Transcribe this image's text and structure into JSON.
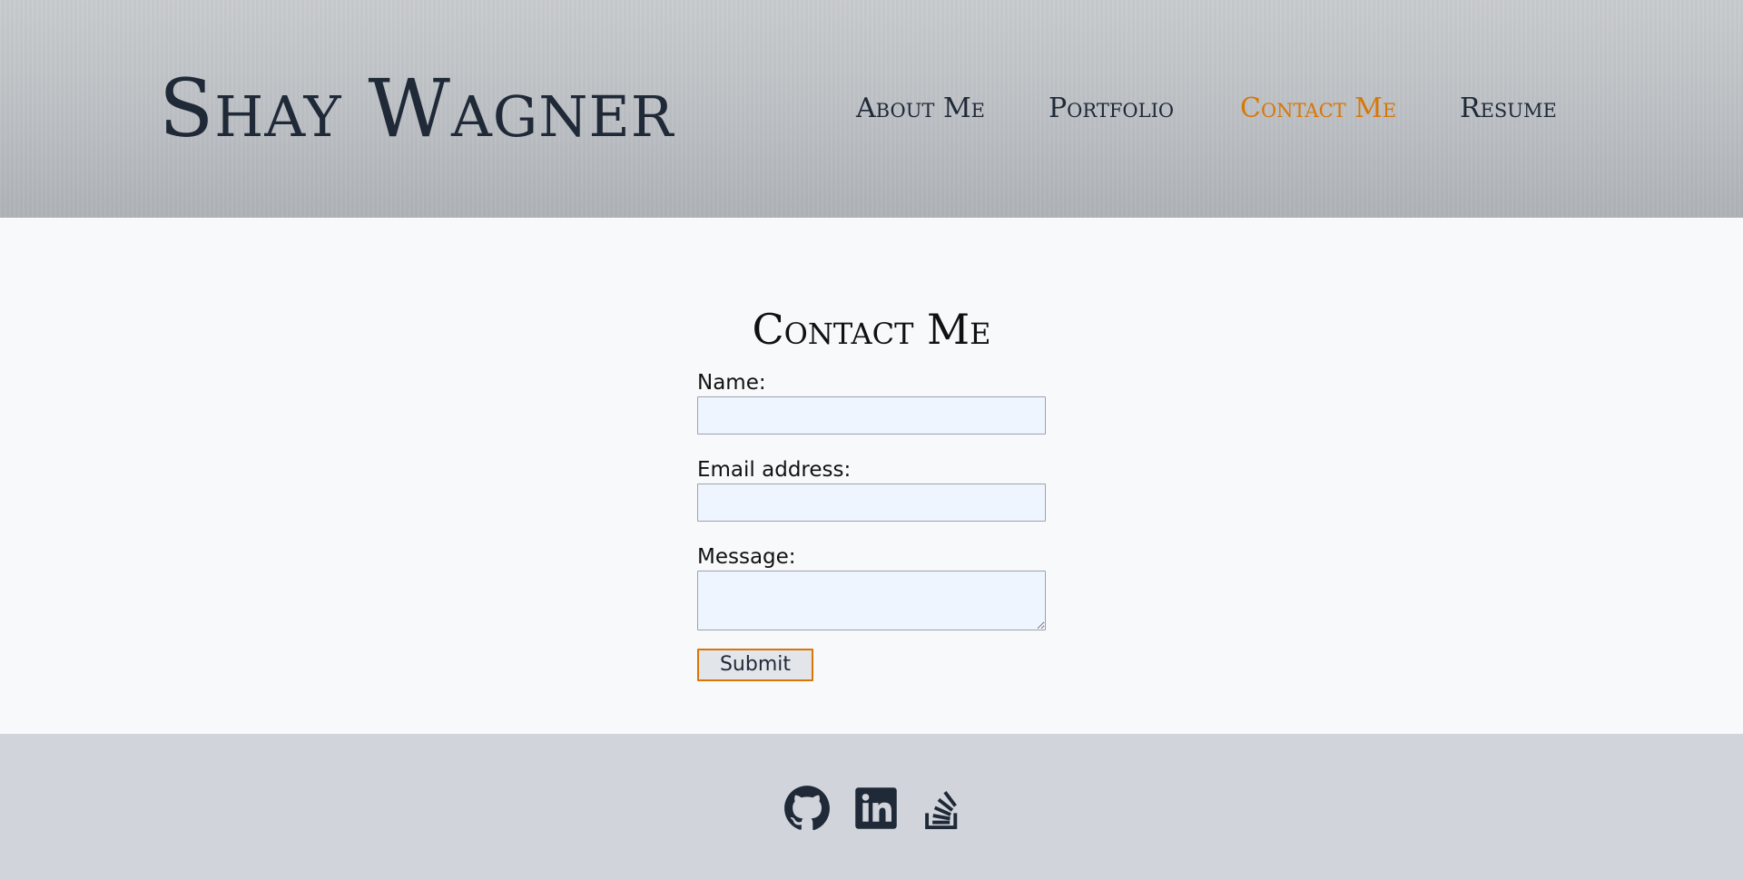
{
  "header": {
    "site_title": "Shay Wagner",
    "nav": [
      {
        "label": "About Me",
        "active": false
      },
      {
        "label": "Portfolio",
        "active": false
      },
      {
        "label": "Contact Me",
        "active": true
      },
      {
        "label": "Resume",
        "active": false
      }
    ]
  },
  "contact": {
    "heading": "Contact Me",
    "name_label": "Name:",
    "name_value": "",
    "email_label": "Email address:",
    "email_value": "",
    "message_label": "Message:",
    "message_value": "",
    "submit_label": "Submit"
  },
  "footer": {
    "social": [
      {
        "icon": "github-icon"
      },
      {
        "icon": "linkedin-icon"
      },
      {
        "icon": "stack-overflow-icon"
      }
    ]
  },
  "colors": {
    "text_dark": "#1f2937",
    "accent": "#d97706",
    "input_bg": "#eff5fe",
    "footer_bg": "#d1d5db",
    "main_bg": "#f8f9fa"
  }
}
